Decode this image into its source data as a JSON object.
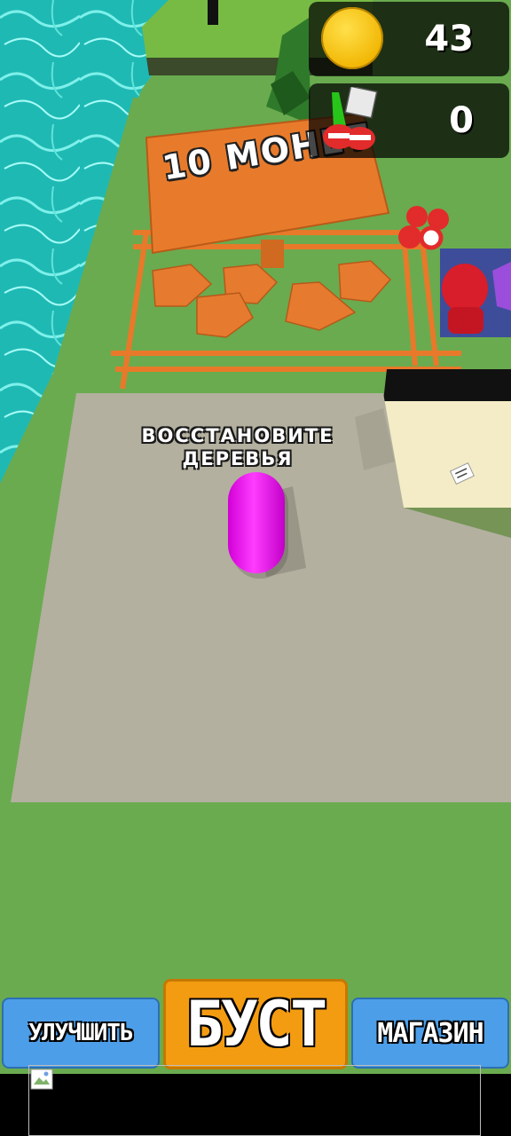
{
  "hud": {
    "coins": "43",
    "items": "0",
    "coin_icon": "gold-coin-icon",
    "item_icon": "drink-bundle-icon"
  },
  "world": {
    "sign_text": "10 МОНЕТ",
    "quest_text": "ВОССТАНОВИТЕ ДЕРЕВЬЯ"
  },
  "buttons": {
    "upgrade": "УЛУЧШИТЬ",
    "boost": "БУСТ",
    "shop": "МАГАЗИН"
  },
  "ad": {
    "icon": "broken-image-icon"
  },
  "colors": {
    "water": "#1fb9b4",
    "grass": "#6aab4f",
    "floor": "#b3b09f",
    "orange": "#e87b2b",
    "player": "#ff2cff",
    "button_blue": "#4d9ee8",
    "button_orange": "#f39c12"
  }
}
